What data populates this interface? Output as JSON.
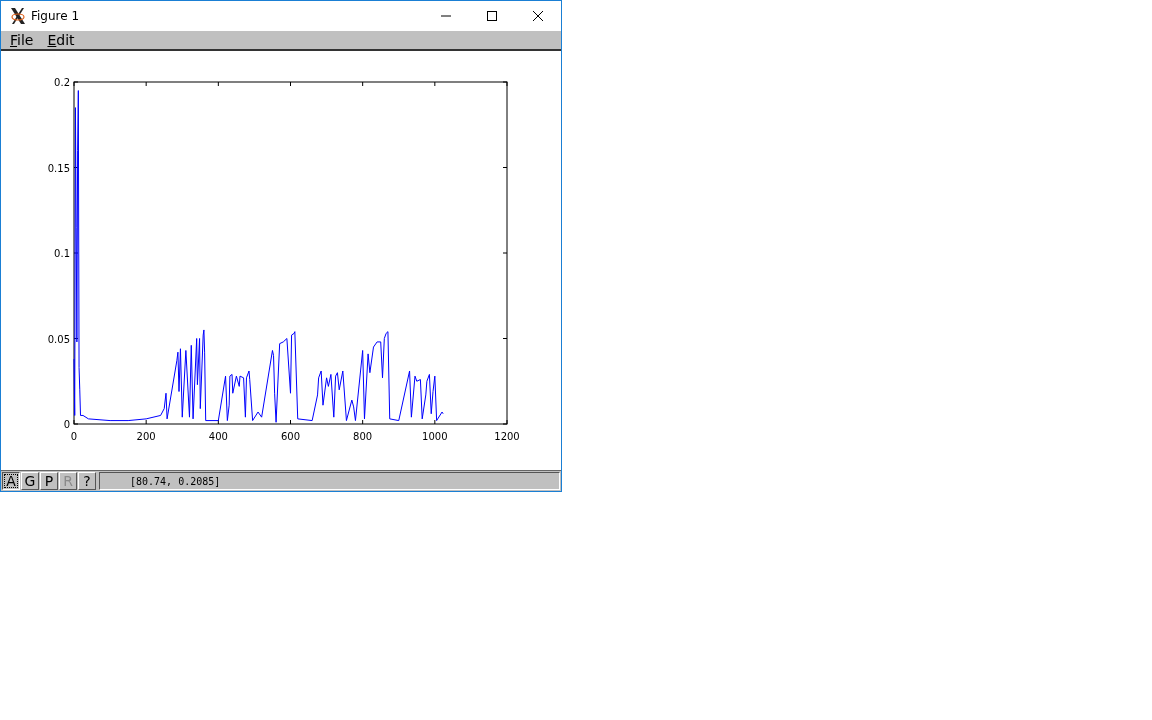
{
  "window": {
    "title": "Figure 1"
  },
  "menu": [
    {
      "label": "File"
    },
    {
      "label": "Edit"
    }
  ],
  "chart_data": {
    "type": "line",
    "xlim": [
      0,
      1200
    ],
    "ylim": [
      0,
      0.2
    ],
    "xticks": [
      {
        "value": 0,
        "label": "0"
      },
      {
        "value": 200,
        "label": "200"
      },
      {
        "value": 400,
        "label": "400"
      },
      {
        "value": 600,
        "label": "600"
      },
      {
        "value": 800,
        "label": "800"
      },
      {
        "value": 1000,
        "label": "1000"
      },
      {
        "value": 1200,
        "label": "1200"
      }
    ],
    "yticks": [
      {
        "value": 0,
        "label": "0"
      },
      {
        "value": 0.05,
        "label": "0.05"
      },
      {
        "value": 0.1,
        "label": "0.1"
      },
      {
        "value": 0.15,
        "label": "0.15"
      },
      {
        "value": 0.2,
        "label": "0.2"
      }
    ],
    "x": [
      0,
      2,
      4,
      6,
      8,
      10,
      12,
      14,
      16,
      18,
      25,
      40,
      100,
      150,
      200,
      240,
      250,
      255,
      258,
      285,
      288,
      291,
      295,
      300,
      310,
      320,
      325,
      330,
      340,
      342,
      348,
      350,
      358,
      360,
      362,
      365,
      400,
      420,
      425,
      430,
      432,
      438,
      440,
      450,
      458,
      460,
      470,
      475,
      478,
      485,
      487,
      495,
      510,
      520,
      550,
      553,
      556,
      560,
      570,
      580,
      590,
      600,
      603,
      610,
      612,
      620,
      660,
      675,
      678,
      685,
      690,
      700,
      705,
      712,
      720,
      725,
      730,
      735,
      745,
      755,
      770,
      775,
      780,
      800,
      805,
      815,
      820,
      830,
      840,
      850,
      855,
      860,
      865,
      870,
      875,
      900,
      930,
      935,
      945,
      950,
      960,
      965,
      975,
      978,
      985,
      990,
      995,
      1000,
      1005,
      1020,
      1023
    ],
    "series": [
      {
        "color": "#0000ff",
        "values": [
          0.038,
          0.005,
          0.185,
          0.115,
          0.048,
          0.16,
          0.195,
          0.033,
          0.02,
          0.005,
          0.005,
          0.003,
          0.002,
          0.002,
          0.003,
          0.005,
          0.009,
          0.018,
          0.003,
          0.037,
          0.042,
          0.019,
          0.044,
          0.004,
          0.043,
          0.004,
          0.046,
          0.003,
          0.05,
          0.023,
          0.05,
          0.009,
          0.052,
          0.055,
          0.042,
          0.002,
          0.002,
          0.028,
          0.002,
          0.011,
          0.028,
          0.029,
          0.018,
          0.028,
          0.022,
          0.028,
          0.027,
          0.004,
          0.027,
          0.031,
          0.026,
          0.002,
          0.007,
          0.004,
          0.043,
          0.04,
          0.018,
          0.001,
          0.047,
          0.048,
          0.05,
          0.018,
          0.052,
          0.053,
          0.054,
          0.003,
          0.002,
          0.017,
          0.027,
          0.031,
          0.011,
          0.027,
          0.022,
          0.029,
          0.004,
          0.028,
          0.03,
          0.02,
          0.031,
          0.002,
          0.014,
          0.01,
          0.002,
          0.043,
          0.003,
          0.041,
          0.03,
          0.045,
          0.048,
          0.048,
          0.027,
          0.05,
          0.053,
          0.054,
          0.003,
          0.002,
          0.031,
          0.004,
          0.028,
          0.025,
          0.026,
          0.003,
          0.017,
          0.025,
          0.029,
          0.006,
          0.019,
          0.028,
          0.002,
          0.007,
          0.006
        ]
      }
    ]
  },
  "toolbar": [
    {
      "label": "A",
      "selected": true,
      "disabled": false
    },
    {
      "label": "G",
      "selected": false,
      "disabled": false
    },
    {
      "label": "P",
      "selected": false,
      "disabled": false
    },
    {
      "label": "R",
      "selected": false,
      "disabled": true
    },
    {
      "label": "?",
      "selected": false,
      "disabled": false
    }
  ],
  "status": "[80.74, 0.2085]"
}
